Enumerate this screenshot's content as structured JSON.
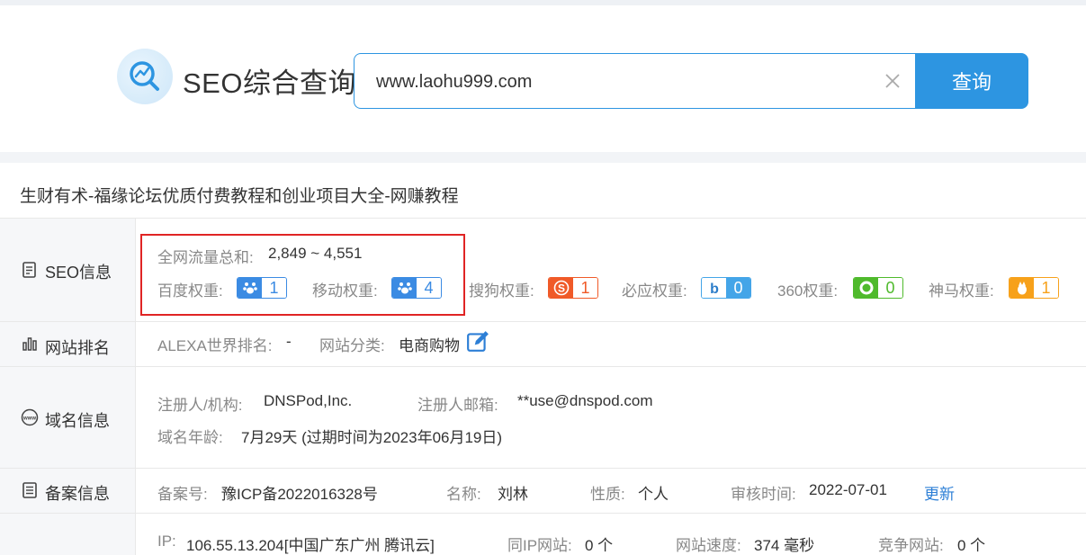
{
  "header": {
    "logo_text": "SEO综合查询",
    "search_value": "www.laohu999.com",
    "search_button": "查询"
  },
  "site_title": "生财有术-福缘论坛优质付费教程和创业项目大全-网赚教程",
  "seo_info": {
    "label": "SEO信息",
    "traffic_label": "全网流量总和:",
    "traffic_value": "2,849 ~ 4,551",
    "weights": [
      {
        "label": "百度权重:",
        "value": "1",
        "icon": "baidu-paw-icon",
        "color": "#3b8be3"
      },
      {
        "label": "移动权重:",
        "value": "4",
        "icon": "baidu-paw-icon",
        "color": "#3b8be3"
      },
      {
        "label": "搜狗权重:",
        "value": "1",
        "icon": "sogou-s-icon",
        "color": "#f05a28"
      },
      {
        "label": "必应权重:",
        "value": "0",
        "icon": "bing-b-icon",
        "color": "#44a5e8"
      },
      {
        "label": "360权重:",
        "value": "0",
        "icon": "360-ring-icon",
        "color": "#4fba2c"
      },
      {
        "label": "神马权重:",
        "value": "1",
        "icon": "shenma-horse-icon",
        "color": "#f7a11a"
      }
    ]
  },
  "ranking": {
    "label": "网站排名",
    "alexa_label": "ALEXA世界排名:",
    "alexa_value": "-",
    "category_label": "网站分类:",
    "category_value": "电商购物"
  },
  "domain": {
    "label": "域名信息",
    "registrar_label": "注册人/机构:",
    "registrar_value": "DNSPod,Inc.",
    "email_label": "注册人邮箱:",
    "email_value": "**use@dnspod.com",
    "age_label": "域名年龄:",
    "age_value": "7月29天 (过期时间为2023年06月19日)"
  },
  "icp": {
    "label": "备案信息",
    "number_label": "备案号:",
    "number_value": "豫ICP备2022016328号",
    "name_label": "名称:",
    "name_value": "刘林",
    "type_label": "性质:",
    "type_value": "个人",
    "audit_label": "审核时间:",
    "audit_value": "2022-07-01",
    "update_link": "更新"
  },
  "server": {
    "ip_label": "IP:",
    "ip_value": "106.55.13.204[中国广东广州 腾讯云]",
    "same_ip_label": "同IP网站:",
    "same_ip_value": "0 个",
    "speed_label": "网站速度:",
    "speed_value": "374 毫秒",
    "competitor_label": "竞争网站:",
    "competitor_value": "0 个"
  }
}
